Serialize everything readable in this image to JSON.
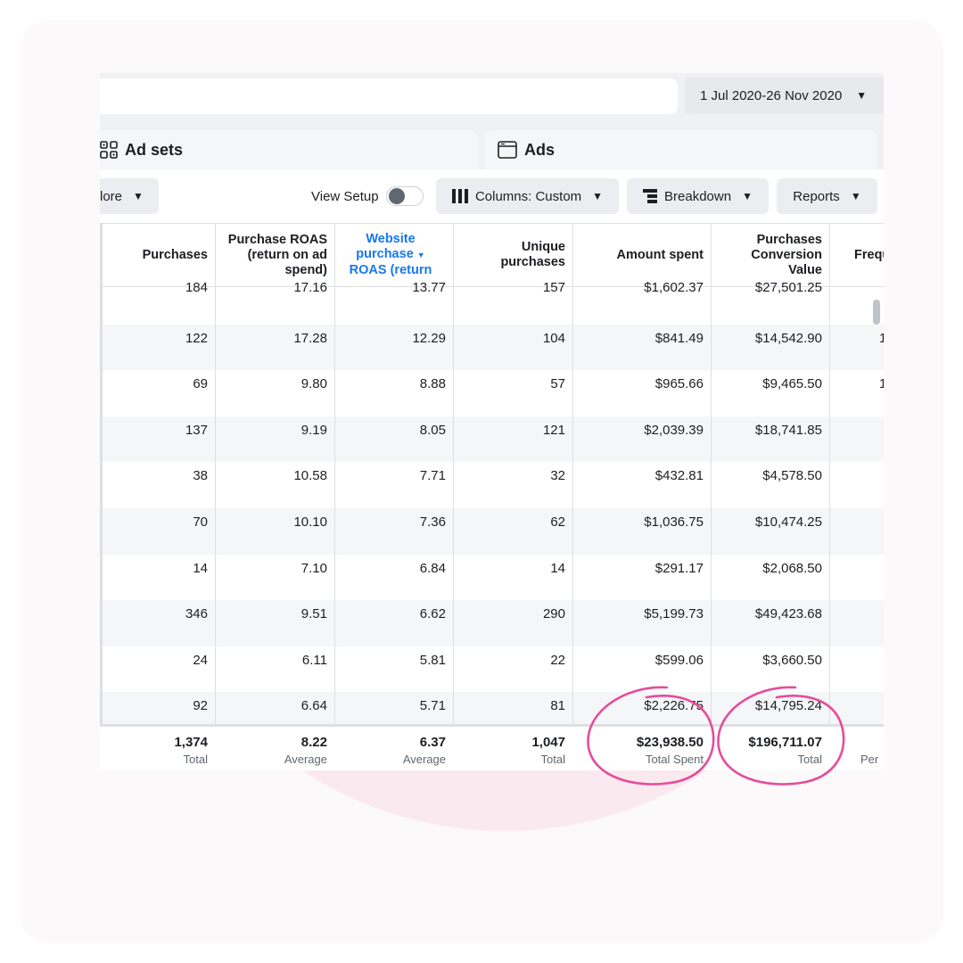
{
  "date_range": {
    "label": "1 Jul 2020-26 Nov 2020"
  },
  "tabs": {
    "ad_sets": "Ad sets",
    "ads": "Ads"
  },
  "toolbar": {
    "more": "lore",
    "view_setup": "View Setup",
    "columns": "Columns: Custom",
    "breakdown": "Breakdown",
    "reports": "Reports"
  },
  "columns": {
    "purchases": "Purchases",
    "purchase_roas": [
      "Purchase ROAS",
      "(return on ad",
      "spend)"
    ],
    "website_roas": [
      "Website",
      "purchase",
      "ROAS (return"
    ],
    "unique_purchases": [
      "Unique",
      "purchases"
    ],
    "amount_spent": "Amount spent",
    "conversion_value": [
      "Purchases",
      "Conversion",
      "Value"
    ],
    "frequency": "Frequ"
  },
  "rows": [
    {
      "purchases": "184",
      "purchase_roas": "17.16",
      "website_roas": "13.77",
      "unique": "157",
      "spent": "$1,602.37",
      "value": "$27,501.25",
      "freq": ""
    },
    {
      "purchases": "122",
      "purchase_roas": "17.28",
      "website_roas": "12.29",
      "unique": "104",
      "spent": "$841.49",
      "value": "$14,542.90",
      "freq": "1"
    },
    {
      "purchases": "69",
      "purchase_roas": "9.80",
      "website_roas": "8.88",
      "unique": "57",
      "spent": "$965.66",
      "value": "$9,465.50",
      "freq": "1"
    },
    {
      "purchases": "137",
      "purchase_roas": "9.19",
      "website_roas": "8.05",
      "unique": "121",
      "spent": "$2,039.39",
      "value": "$18,741.85",
      "freq": ""
    },
    {
      "purchases": "38",
      "purchase_roas": "10.58",
      "website_roas": "7.71",
      "unique": "32",
      "spent": "$432.81",
      "value": "$4,578.50",
      "freq": ""
    },
    {
      "purchases": "70",
      "purchase_roas": "10.10",
      "website_roas": "7.36",
      "unique": "62",
      "spent": "$1,036.75",
      "value": "$10,474.25",
      "freq": ""
    },
    {
      "purchases": "14",
      "purchase_roas": "7.10",
      "website_roas": "6.84",
      "unique": "14",
      "spent": "$291.17",
      "value": "$2,068.50",
      "freq": ""
    },
    {
      "purchases": "346",
      "purchase_roas": "9.51",
      "website_roas": "6.62",
      "unique": "290",
      "spent": "$5,199.73",
      "value": "$49,423.68",
      "freq": ""
    },
    {
      "purchases": "24",
      "purchase_roas": "6.11",
      "website_roas": "5.81",
      "unique": "22",
      "spent": "$599.06",
      "value": "$3,660.50",
      "freq": ""
    },
    {
      "purchases": "92",
      "purchase_roas": "6.64",
      "website_roas": "5.71",
      "unique": "81",
      "spent": "$2,226.75",
      "value": "$14,795.24",
      "freq": ""
    }
  ],
  "totals": {
    "purchases": {
      "value": "1,374",
      "label": "Total"
    },
    "purchase_roas": {
      "value": "8.22",
      "label": "Average"
    },
    "website_roas": {
      "value": "6.37",
      "label": "Average"
    },
    "unique": {
      "value": "1,047",
      "label": "Total"
    },
    "spent": {
      "value": "$23,938.50",
      "label": "Total Spent"
    },
    "value": {
      "value": "$196,711.07",
      "label": "Total"
    },
    "freq": {
      "label": "Per I"
    }
  },
  "colors": {
    "sorted_column": "#1877f2",
    "annotation": "#e64c9a",
    "background_circle": "#fbe9f0"
  }
}
